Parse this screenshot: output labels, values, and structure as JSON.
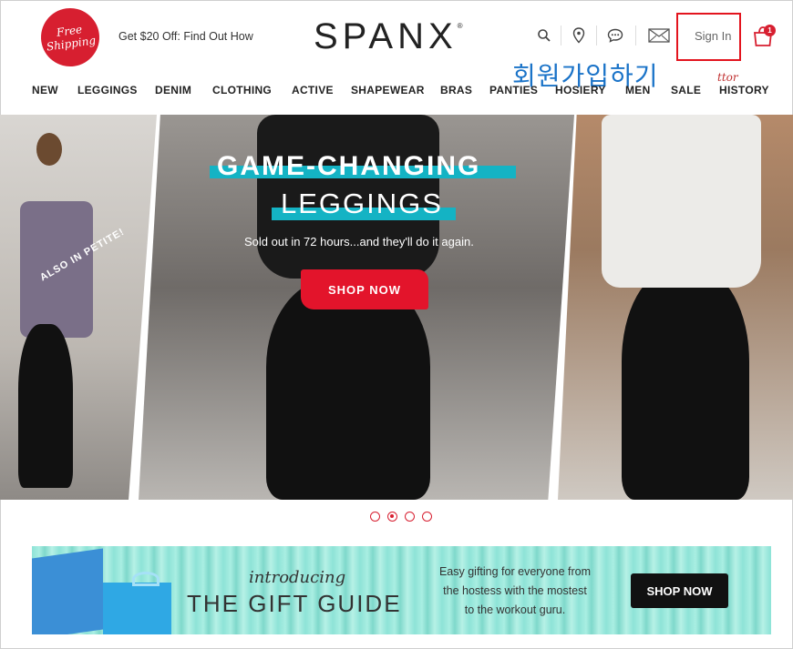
{
  "header": {
    "badge_line1": "Free",
    "badge_line2": "Shipping",
    "promo": "Get $20 Off: Find Out How",
    "logo": "SPANX",
    "logo_mark": "®",
    "signin": "Sign In",
    "cart_count": "1",
    "annotation_korean": "회원가입하기",
    "icons": [
      "search-icon",
      "location-pin-icon",
      "chat-icon",
      "mail-icon",
      "shopping-bag-icon"
    ]
  },
  "nav": {
    "items": [
      "NEW",
      "LEGGINGS",
      "DENIM",
      "CLOTHING",
      "ACTIVE",
      "SHAPEWEAR",
      "BRAS",
      "PANTIES",
      "HOSIERY",
      "MEN",
      "SALE",
      "HISTORY"
    ],
    "handwritten_note": "ttor"
  },
  "hero": {
    "headline_line1": "GAME-CHANGING",
    "headline_line2": "LEGGINGS",
    "subline": "Sold out in 72 hours...and they'll do it again.",
    "cta": "SHOP NOW",
    "petite_label": "ALSO IN PETITE!",
    "accent_color": "#14b3c4",
    "cta_color": "#e3142b"
  },
  "carousel": {
    "dots": 4,
    "active_index": 1
  },
  "gift_banner": {
    "introducing": "introducing",
    "title": "THE GIFT GUIDE",
    "desc_line1": "Easy gifting for everyone from",
    "desc_line2": "the hostess with the mostest",
    "desc_line3": "to the workout guru.",
    "cta": "SHOP NOW"
  }
}
